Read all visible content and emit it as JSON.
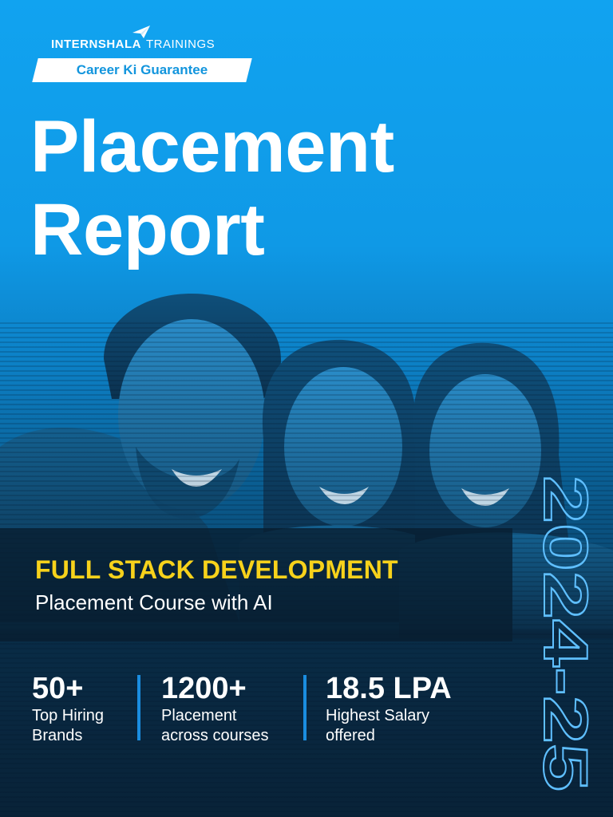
{
  "brand": {
    "name": "INTERNSHALA",
    "suffix": "TRAININGS",
    "tagline": "Career Ki Guarantee",
    "plane_icon": "paper-plane-icon"
  },
  "title": {
    "line1": "Placement",
    "line2": "Report"
  },
  "course": {
    "name": "FULL STACK DEVELOPMENT",
    "subtitle": "Placement Course with AI"
  },
  "stats": [
    {
      "value": "50+",
      "label_line1": "Top Hiring",
      "label_line2": "Brands"
    },
    {
      "value": "1200+",
      "label_line1": "Placement",
      "label_line2": "across courses"
    },
    {
      "value": "18.5 LPA",
      "label_line1": "Highest Salary",
      "label_line2": "offered"
    }
  ],
  "year": "2024-25",
  "colors": {
    "background_top": "#11a3f0",
    "accent_yellow": "#f7d21b",
    "divider_blue": "#1a8de0",
    "tagline_text": "#1295dd"
  }
}
